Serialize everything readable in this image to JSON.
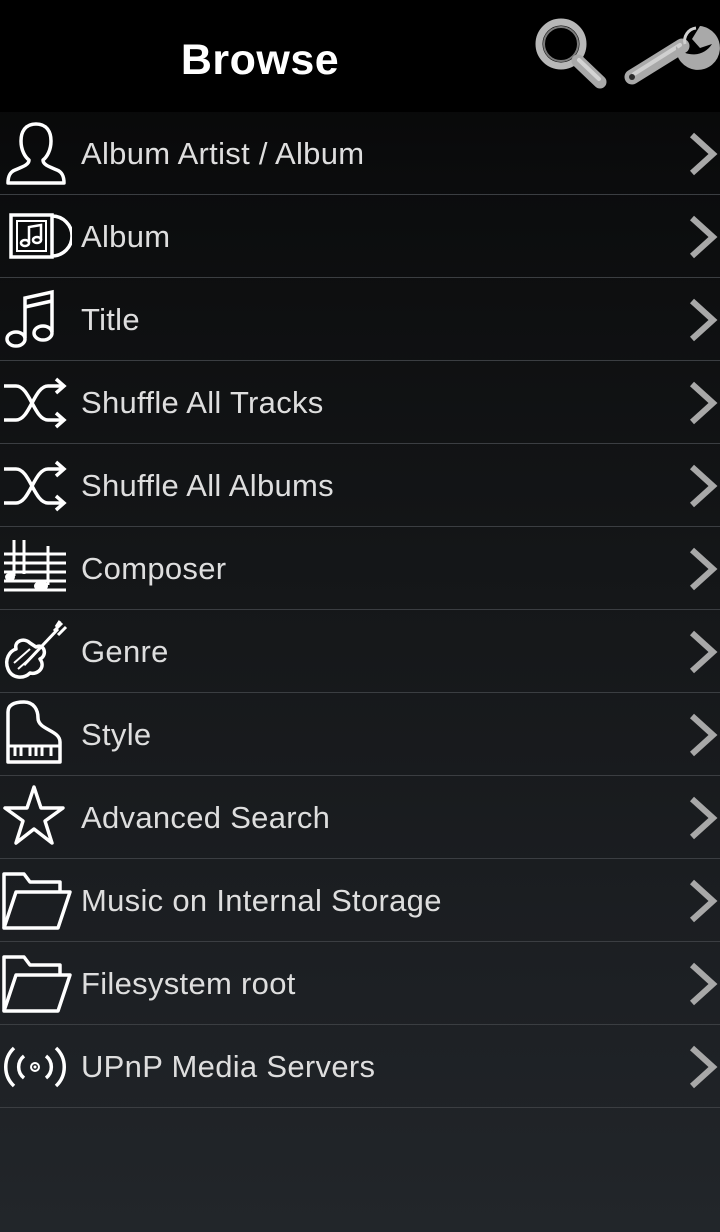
{
  "header": {
    "title": "Browse",
    "search_icon": "search-icon",
    "settings_icon": "wrench-icon"
  },
  "colors": {
    "header_bg": "#000000",
    "list_text": "#dedede",
    "divider": "#3b3e42",
    "icon_white": "#ffffff",
    "header_icon_gray": "#a9a9a9"
  },
  "items": [
    {
      "label": "Album Artist / Album",
      "icon": "person-icon"
    },
    {
      "label": "Album",
      "icon": "album-icon"
    },
    {
      "label": "Title",
      "icon": "music-note-icon"
    },
    {
      "label": "Shuffle All Tracks",
      "icon": "shuffle-icon"
    },
    {
      "label": "Shuffle All Albums",
      "icon": "shuffle-icon"
    },
    {
      "label": "Composer",
      "icon": "sheet-music-icon"
    },
    {
      "label": "Genre",
      "icon": "violin-icon"
    },
    {
      "label": "Style",
      "icon": "piano-icon"
    },
    {
      "label": "Advanced Search",
      "icon": "star-icon"
    },
    {
      "label": "Music on Internal Storage",
      "icon": "folder-icon"
    },
    {
      "label": "Filesystem root",
      "icon": "folder-icon"
    },
    {
      "label": "UPnP Media Servers",
      "icon": "upnp-icon"
    }
  ]
}
